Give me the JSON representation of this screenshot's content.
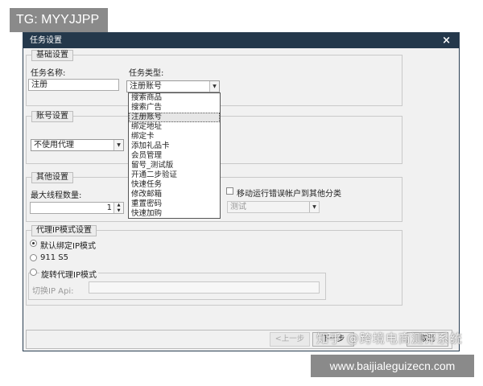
{
  "tg_badge": "TG: MYYJJPP",
  "window": {
    "title": "任务设置",
    "close_glyph": "×"
  },
  "basic": {
    "group_title": "基础设置",
    "task_name_label": "任务名称:",
    "task_name_value": "注册",
    "task_type_label": "任务类型:",
    "task_type_selected": "注册账号",
    "task_type_options": [
      "搜索商品",
      "搜索广告",
      "注册账号",
      "绑定地址",
      "绑定卡",
      "添加礼品卡",
      "会员管理",
      "留号_测试版",
      "开通二步验证",
      "快速任务",
      "修改邮箱",
      "重置密码",
      "快速加购"
    ],
    "selected_index": 2
  },
  "account": {
    "group_title": "账号设置",
    "proxy_value": "不使用代理"
  },
  "other": {
    "group_title": "其他设置",
    "max_threads_label": "最大线程数量:",
    "max_threads_value": "1",
    "move_error_label": "移动运行错误帐户到其他分类",
    "category_value": "测试"
  },
  "proxy_ip": {
    "group_title": "代理IP模式设置",
    "option_default": "默认绑定IP模式",
    "option_911": "911 S5",
    "option_rotate": "旋转代理IP模式",
    "switch_ip_label": "切换IP Api:",
    "switch_ip_value": ""
  },
  "footer": {
    "prev": "<上一步",
    "next": "下一步",
    "cancel": "取消"
  },
  "watermark": "知乎 @跨境电商测评系统",
  "url_badge": "www.baijialeguizecn.com"
}
